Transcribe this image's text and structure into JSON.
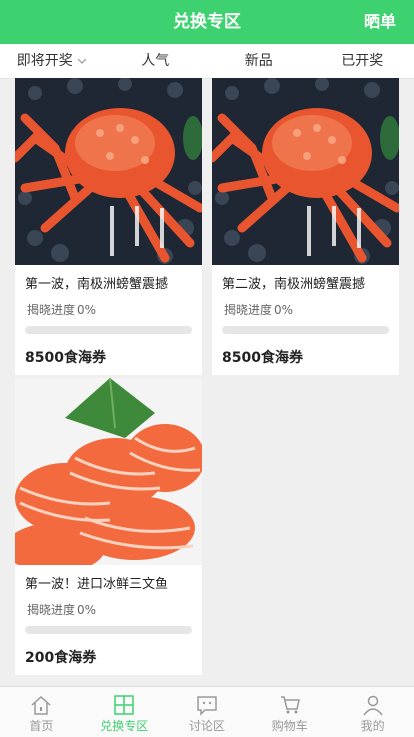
{
  "header": {
    "title": "兑换专区",
    "share_label": "晒单"
  },
  "tabs": [
    {
      "label": "即将开奖"
    },
    {
      "label": "人气"
    },
    {
      "label": "新品"
    },
    {
      "label": "已开奖"
    }
  ],
  "products": [
    {
      "name": "第一波，南极洲螃蟹震撼",
      "progress_label": "揭晓进度",
      "progress_text": "0%",
      "progress": 0,
      "price": "8500食海券",
      "image": "king-crab"
    },
    {
      "name": "第二波，南极洲螃蟹震撼",
      "progress_label": "揭晓进度",
      "progress_text": "0%",
      "progress": 0,
      "price": "8500食海券",
      "image": "king-crab"
    },
    {
      "name": "第一波！进口冰鲜三文鱼",
      "progress_label": "揭晓进度",
      "progress_text": "0%",
      "progress": 0,
      "price": "200食海券",
      "image": "salmon-sashimi"
    }
  ],
  "tabbar": [
    {
      "label": "首页",
      "icon": "home-icon"
    },
    {
      "label": "兑换专区",
      "icon": "grid-icon",
      "active": true
    },
    {
      "label": "讨论区",
      "icon": "chat-icon"
    },
    {
      "label": "购物车",
      "icon": "cart-icon"
    },
    {
      "label": "我的",
      "icon": "user-icon"
    }
  ],
  "colors": {
    "accent": "#3dd16f",
    "background": "#efefef"
  }
}
